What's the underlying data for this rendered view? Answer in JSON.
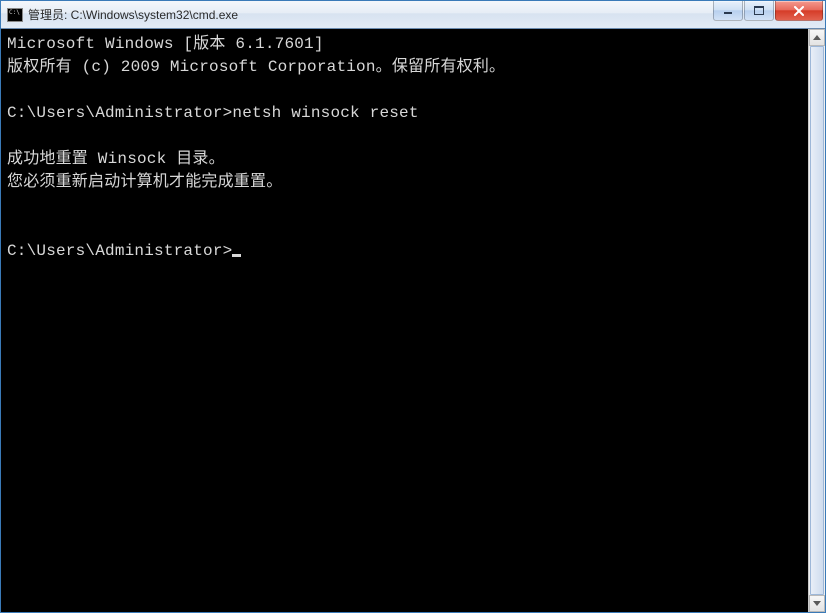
{
  "window": {
    "title": "管理员: C:\\Windows\\system32\\cmd.exe"
  },
  "terminal": {
    "lines": [
      "Microsoft Windows [版本 6.1.7601]",
      "版权所有 (c) 2009 Microsoft Corporation。保留所有权利。",
      "",
      "C:\\Users\\Administrator>netsh winsock reset",
      "",
      "成功地重置 Winsock 目录。",
      "您必须重新启动计算机才能完成重置。",
      "",
      "",
      "C:\\Users\\Administrator>"
    ]
  }
}
